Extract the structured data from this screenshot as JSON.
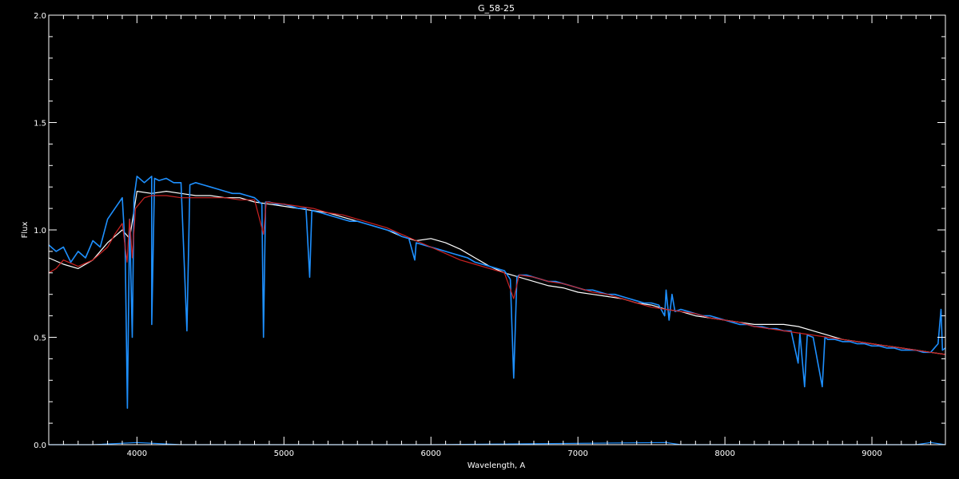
{
  "chart_data": {
    "type": "line",
    "title": "G_58-25",
    "xlabel": "Wavelength, A",
    "ylabel": "Flux",
    "xlim": [
      3400,
      9500
    ],
    "ylim": [
      0.0,
      2.0
    ],
    "x_ticks": [
      "4000",
      "5000",
      "6000",
      "7000",
      "8000",
      "9000"
    ],
    "y_ticks": [
      "0.0",
      "0.5",
      "1.0",
      "1.5",
      "2.0"
    ],
    "grid": false,
    "background": "#000000",
    "axis_color": "#ffffff",
    "series": [
      {
        "color": "#ffffff",
        "points": [
          [
            3400,
            0.87
          ],
          [
            3500,
            0.84
          ],
          [
            3600,
            0.82
          ],
          [
            3700,
            0.86
          ],
          [
            3800,
            0.94
          ],
          [
            3900,
            1.0
          ],
          [
            3950,
            0.96
          ],
          [
            4000,
            1.18
          ],
          [
            4100,
            1.17
          ],
          [
            4200,
            1.18
          ],
          [
            4300,
            1.17
          ],
          [
            4400,
            1.16
          ],
          [
            4500,
            1.16
          ],
          [
            4600,
            1.15
          ],
          [
            4700,
            1.15
          ],
          [
            4800,
            1.13
          ],
          [
            4900,
            1.12
          ],
          [
            5000,
            1.11
          ],
          [
            5100,
            1.1
          ],
          [
            5200,
            1.09
          ],
          [
            5300,
            1.08
          ],
          [
            5400,
            1.06
          ],
          [
            5500,
            1.04
          ],
          [
            5600,
            1.02
          ],
          [
            5700,
            1.0
          ],
          [
            5800,
            0.97
          ],
          [
            5900,
            0.95
          ],
          [
            6000,
            0.96
          ],
          [
            6100,
            0.94
          ],
          [
            6200,
            0.91
          ],
          [
            6300,
            0.87
          ],
          [
            6400,
            0.83
          ],
          [
            6500,
            0.8
          ],
          [
            6600,
            0.78
          ],
          [
            6700,
            0.76
          ],
          [
            6800,
            0.74
          ],
          [
            6900,
            0.73
          ],
          [
            7000,
            0.71
          ],
          [
            7100,
            0.7
          ],
          [
            7200,
            0.69
          ],
          [
            7300,
            0.68
          ],
          [
            7400,
            0.66
          ],
          [
            7500,
            0.65
          ],
          [
            7600,
            0.63
          ],
          [
            7700,
            0.62
          ],
          [
            7800,
            0.6
          ],
          [
            7900,
            0.59
          ],
          [
            8000,
            0.58
          ],
          [
            8100,
            0.57
          ],
          [
            8200,
            0.56
          ],
          [
            8300,
            0.56
          ],
          [
            8400,
            0.56
          ],
          [
            8500,
            0.55
          ],
          [
            8600,
            0.53
          ],
          [
            8700,
            0.51
          ],
          [
            8800,
            0.49
          ],
          [
            8900,
            0.48
          ],
          [
            9000,
            0.47
          ],
          [
            9100,
            0.46
          ],
          [
            9200,
            0.45
          ],
          [
            9300,
            0.44
          ],
          [
            9400,
            0.43
          ],
          [
            9500,
            0.42
          ]
        ]
      },
      {
        "color": "#1e90ff",
        "points": [
          [
            3400,
            0.93
          ],
          [
            3450,
            0.9
          ],
          [
            3500,
            0.92
          ],
          [
            3550,
            0.85
          ],
          [
            3600,
            0.9
          ],
          [
            3650,
            0.87
          ],
          [
            3700,
            0.95
          ],
          [
            3750,
            0.92
          ],
          [
            3800,
            1.05
          ],
          [
            3850,
            1.1
          ],
          [
            3900,
            1.15
          ],
          [
            3920,
            0.92
          ],
          [
            3935,
            0.17
          ],
          [
            3950,
            1.05
          ],
          [
            3968,
            0.5
          ],
          [
            3980,
            1.15
          ],
          [
            4000,
            1.25
          ],
          [
            4050,
            1.22
          ],
          [
            4100,
            1.25
          ],
          [
            4101,
            0.56
          ],
          [
            4120,
            1.24
          ],
          [
            4150,
            1.23
          ],
          [
            4200,
            1.24
          ],
          [
            4250,
            1.22
          ],
          [
            4300,
            1.22
          ],
          [
            4340,
            0.53
          ],
          [
            4360,
            1.21
          ],
          [
            4400,
            1.22
          ],
          [
            4450,
            1.21
          ],
          [
            4500,
            1.2
          ],
          [
            4550,
            1.19
          ],
          [
            4600,
            1.18
          ],
          [
            4650,
            1.17
          ],
          [
            4700,
            1.17
          ],
          [
            4750,
            1.16
          ],
          [
            4800,
            1.15
          ],
          [
            4850,
            1.12
          ],
          [
            4861,
            0.5
          ],
          [
            4875,
            1.13
          ],
          [
            4900,
            1.13
          ],
          [
            4950,
            1.12
          ],
          [
            5000,
            1.12
          ],
          [
            5050,
            1.11
          ],
          [
            5100,
            1.1
          ],
          [
            5150,
            1.1
          ],
          [
            5175,
            0.78
          ],
          [
            5190,
            1.09
          ],
          [
            5250,
            1.08
          ],
          [
            5300,
            1.07
          ],
          [
            5350,
            1.06
          ],
          [
            5400,
            1.05
          ],
          [
            5450,
            1.04
          ],
          [
            5500,
            1.04
          ],
          [
            5550,
            1.03
          ],
          [
            5600,
            1.02
          ],
          [
            5650,
            1.01
          ],
          [
            5700,
            1.0
          ],
          [
            5750,
            0.99
          ],
          [
            5800,
            0.97
          ],
          [
            5850,
            0.96
          ],
          [
            5890,
            0.86
          ],
          [
            5900,
            0.94
          ],
          [
            5950,
            0.93
          ],
          [
            6000,
            0.92
          ],
          [
            6050,
            0.91
          ],
          [
            6100,
            0.9
          ],
          [
            6150,
            0.89
          ],
          [
            6200,
            0.88
          ],
          [
            6250,
            0.87
          ],
          [
            6300,
            0.85
          ],
          [
            6350,
            0.84
          ],
          [
            6400,
            0.83
          ],
          [
            6450,
            0.82
          ],
          [
            6500,
            0.81
          ],
          [
            6540,
            0.77
          ],
          [
            6563,
            0.31
          ],
          [
            6585,
            0.78
          ],
          [
            6600,
            0.79
          ],
          [
            6650,
            0.79
          ],
          [
            6700,
            0.78
          ],
          [
            6750,
            0.77
          ],
          [
            6800,
            0.76
          ],
          [
            6850,
            0.76
          ],
          [
            6900,
            0.75
          ],
          [
            6950,
            0.74
          ],
          [
            7000,
            0.73
          ],
          [
            7050,
            0.72
          ],
          [
            7100,
            0.72
          ],
          [
            7150,
            0.71
          ],
          [
            7200,
            0.7
          ],
          [
            7250,
            0.7
          ],
          [
            7300,
            0.69
          ],
          [
            7350,
            0.68
          ],
          [
            7400,
            0.67
          ],
          [
            7450,
            0.66
          ],
          [
            7500,
            0.66
          ],
          [
            7550,
            0.65
          ],
          [
            7590,
            0.6
          ],
          [
            7600,
            0.72
          ],
          [
            7620,
            0.58
          ],
          [
            7640,
            0.7
          ],
          [
            7660,
            0.62
          ],
          [
            7700,
            0.63
          ],
          [
            7750,
            0.62
          ],
          [
            7800,
            0.61
          ],
          [
            7850,
            0.6
          ],
          [
            7900,
            0.6
          ],
          [
            7950,
            0.59
          ],
          [
            8000,
            0.58
          ],
          [
            8050,
            0.57
          ],
          [
            8100,
            0.56
          ],
          [
            8150,
            0.56
          ],
          [
            8200,
            0.55
          ],
          [
            8250,
            0.55
          ],
          [
            8300,
            0.54
          ],
          [
            8350,
            0.54
          ],
          [
            8400,
            0.53
          ],
          [
            8450,
            0.53
          ],
          [
            8498,
            0.38
          ],
          [
            8510,
            0.52
          ],
          [
            8542,
            0.27
          ],
          [
            8560,
            0.51
          ],
          [
            8600,
            0.5
          ],
          [
            8662,
            0.27
          ],
          [
            8680,
            0.5
          ],
          [
            8700,
            0.49
          ],
          [
            8750,
            0.49
          ],
          [
            8800,
            0.48
          ],
          [
            8850,
            0.48
          ],
          [
            8900,
            0.47
          ],
          [
            8950,
            0.47
          ],
          [
            9000,
            0.46
          ],
          [
            9050,
            0.46
          ],
          [
            9100,
            0.45
          ],
          [
            9150,
            0.45
          ],
          [
            9200,
            0.44
          ],
          [
            9250,
            0.44
          ],
          [
            9300,
            0.44
          ],
          [
            9350,
            0.43
          ],
          [
            9400,
            0.43
          ],
          [
            9450,
            0.47
          ],
          [
            9470,
            0.63
          ],
          [
            9480,
            0.44
          ],
          [
            9500,
            0.45
          ]
        ]
      },
      {
        "color": "#cc2222",
        "points": [
          [
            3400,
            0.8
          ],
          [
            3450,
            0.82
          ],
          [
            3500,
            0.86
          ],
          [
            3600,
            0.83
          ],
          [
            3700,
            0.86
          ],
          [
            3800,
            0.92
          ],
          [
            3850,
            0.98
          ],
          [
            3900,
            1.03
          ],
          [
            3933,
            0.85
          ],
          [
            3950,
            1.05
          ],
          [
            3968,
            0.87
          ],
          [
            3990,
            1.1
          ],
          [
            4050,
            1.15
          ],
          [
            4100,
            1.16
          ],
          [
            4200,
            1.16
          ],
          [
            4300,
            1.15
          ],
          [
            4400,
            1.15
          ],
          [
            4500,
            1.15
          ],
          [
            4600,
            1.15
          ],
          [
            4700,
            1.14
          ],
          [
            4800,
            1.14
          ],
          [
            4861,
            0.98
          ],
          [
            4880,
            1.13
          ],
          [
            5000,
            1.12
          ],
          [
            5100,
            1.11
          ],
          [
            5200,
            1.1
          ],
          [
            5300,
            1.08
          ],
          [
            5400,
            1.07
          ],
          [
            5500,
            1.05
          ],
          [
            5600,
            1.03
          ],
          [
            5700,
            1.01
          ],
          [
            5800,
            0.98
          ],
          [
            5900,
            0.95
          ],
          [
            6000,
            0.92
          ],
          [
            6100,
            0.89
          ],
          [
            6200,
            0.86
          ],
          [
            6300,
            0.84
          ],
          [
            6400,
            0.82
          ],
          [
            6500,
            0.8
          ],
          [
            6563,
            0.68
          ],
          [
            6600,
            0.79
          ],
          [
            6700,
            0.78
          ],
          [
            6800,
            0.76
          ],
          [
            6900,
            0.75
          ],
          [
            7000,
            0.73
          ],
          [
            7100,
            0.71
          ],
          [
            7200,
            0.7
          ],
          [
            7300,
            0.68
          ],
          [
            7400,
            0.66
          ],
          [
            7500,
            0.64
          ],
          [
            7600,
            0.63
          ],
          [
            7700,
            0.62
          ],
          [
            7800,
            0.61
          ],
          [
            7900,
            0.59
          ],
          [
            8000,
            0.58
          ],
          [
            8100,
            0.57
          ],
          [
            8200,
            0.55
          ],
          [
            8300,
            0.54
          ],
          [
            8400,
            0.53
          ],
          [
            8500,
            0.52
          ],
          [
            8600,
            0.51
          ],
          [
            8700,
            0.5
          ],
          [
            8800,
            0.49
          ],
          [
            8900,
            0.48
          ],
          [
            9000,
            0.47
          ],
          [
            9100,
            0.46
          ],
          [
            9200,
            0.45
          ],
          [
            9300,
            0.44
          ],
          [
            9400,
            0.43
          ],
          [
            9500,
            0.42
          ]
        ]
      },
      {
        "color": "#1e90ff",
        "points": [
          [
            3400,
            0.0
          ],
          [
            3700,
            0.0
          ],
          [
            4000,
            0.01
          ],
          [
            4300,
            0.0
          ],
          [
            6000,
            0.0
          ],
          [
            7600,
            0.01
          ],
          [
            7700,
            0.0
          ],
          [
            9300,
            0.0
          ],
          [
            9400,
            0.01
          ],
          [
            9500,
            0.0
          ]
        ]
      }
    ]
  }
}
